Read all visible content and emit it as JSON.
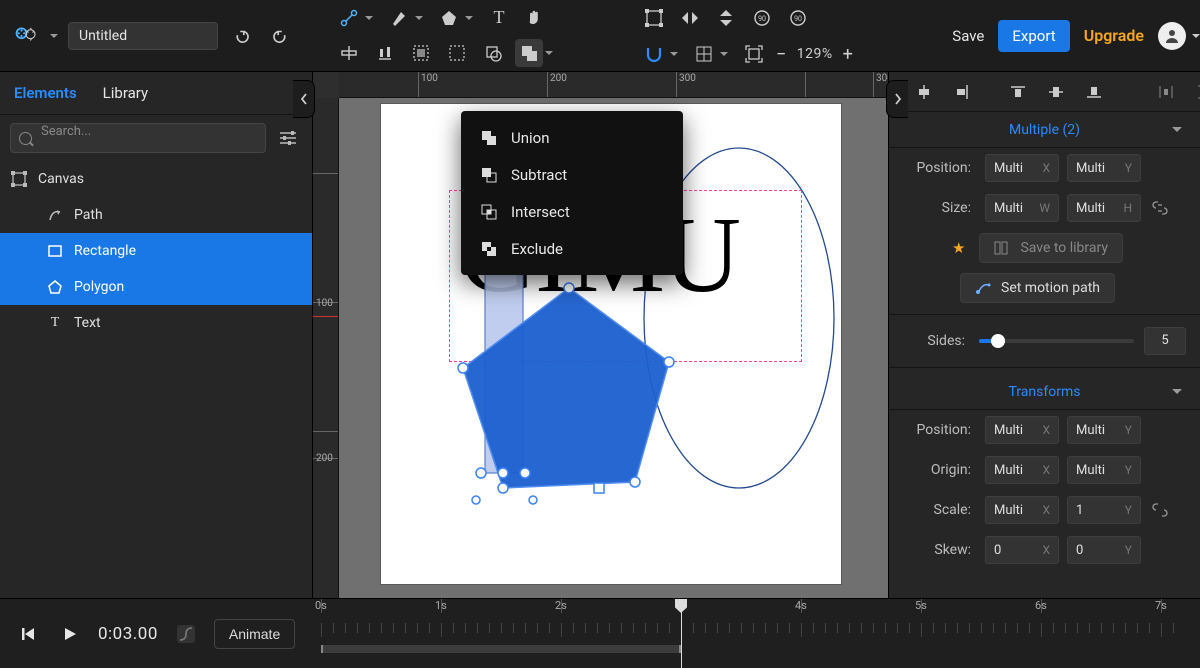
{
  "topbar": {
    "filename": "Untitled",
    "save": "Save",
    "export": "Export",
    "upgrade": "Upgrade",
    "zoom": "129%"
  },
  "left": {
    "tab_elements": "Elements",
    "tab_library": "Library",
    "search_placeholder": "Search...",
    "root": "Canvas",
    "items": [
      {
        "label": "Path"
      },
      {
        "label": "Rectangle"
      },
      {
        "label": "Polygon"
      },
      {
        "label": "Text"
      }
    ]
  },
  "dropdown": {
    "union": "Union",
    "subtract": "Subtract",
    "intersect": "Intersect",
    "exclude": "Exclude"
  },
  "canvas": {
    "text": "GIMU",
    "ruler_h": [
      "100",
      "200",
      "300"
    ],
    "ruler_v": [
      "100",
      "200"
    ]
  },
  "right": {
    "selection_title": "Multiple (2)",
    "position_label": "Position:",
    "size_label": "Size:",
    "origin_label": "Origin:",
    "scale_label": "Scale:",
    "skew_label": "Skew:",
    "sides_label": "Sides:",
    "transforms_title": "Transforms",
    "save_lib": "Save to library",
    "motion_path": "Set motion path",
    "multi": "Multi",
    "one": "1",
    "zero": "0",
    "sides_value": "5"
  },
  "timeline": {
    "current_time": "0:03.00",
    "animate": "Animate",
    "labels": [
      "0s",
      "1s",
      "2s",
      "3s",
      "4s",
      "5s",
      "6s",
      "7s"
    ]
  }
}
